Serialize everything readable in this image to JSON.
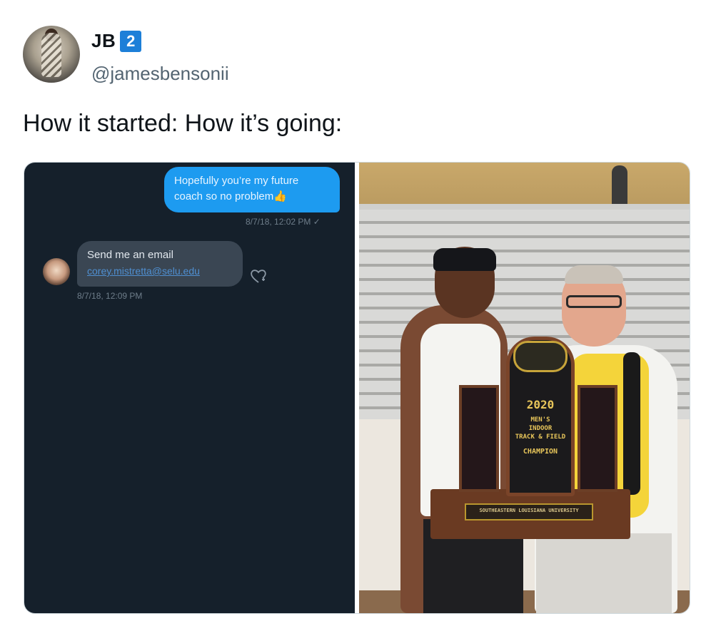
{
  "tweet": {
    "author_name": "JB",
    "badge": "2",
    "handle": "@jamesbensonii",
    "text": "How it started: How it’s going:"
  },
  "screenshot_chat": {
    "sent_message": "Hopefully you’re my future coach so no problem👍",
    "sent_timestamp": "8/7/18, 12:02 PM ✓",
    "received_message": "Send me an email",
    "received_link": "corey.mistretta@selu.edu",
    "received_timestamp": "8/7/18, 12:09 PM"
  },
  "photo": {
    "trophy_year": "2020",
    "trophy_lines": [
      "MEN'S",
      "INDOOR",
      "TRACK & FIELD",
      "CHAMPION"
    ],
    "trophy_plate": "SOUTHEASTERN LOUISIANA UNIVERSITY"
  },
  "colors": {
    "badge_bg": "#1d7fd8",
    "dm_background": "#15202b",
    "sent_bubble": "#1d9bf0",
    "received_bubble": "#3a4653"
  }
}
